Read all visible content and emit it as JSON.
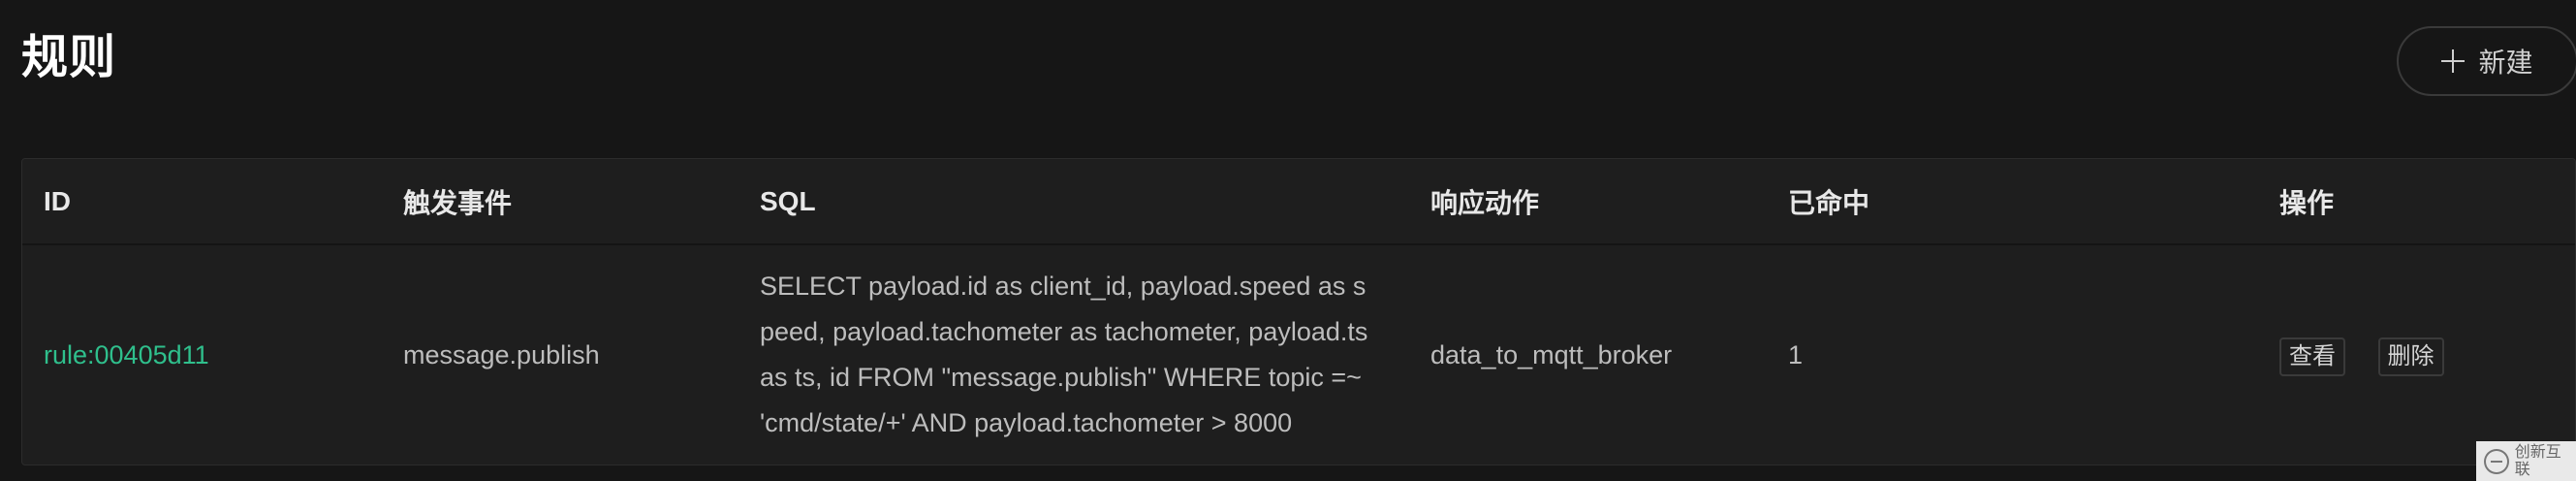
{
  "header": {
    "title": "规则",
    "new_button_label": "新建"
  },
  "table": {
    "columns": [
      "ID",
      "触发事件",
      "SQL",
      "响应动作",
      "已命中",
      "操作"
    ],
    "rows": [
      {
        "id": "rule:00405d11",
        "event": "message.publish",
        "sql": "SELECT payload.id as client_id, payload.speed as speed, payload.tachometer as tachometer, payload.ts as ts, id FROM \"message.publish\" WHERE topic =~ 'cmd/state/+' AND payload.tachometer > 8000",
        "action": "data_to_mqtt_broker",
        "hits": "1",
        "ops": {
          "view": "查看",
          "delete": "删除"
        }
      }
    ]
  },
  "watermark": {
    "text": "创新互联"
  },
  "colors": {
    "background": "#161616",
    "table_background": "#1e1e1e",
    "accent": "#2fbf8c"
  }
}
